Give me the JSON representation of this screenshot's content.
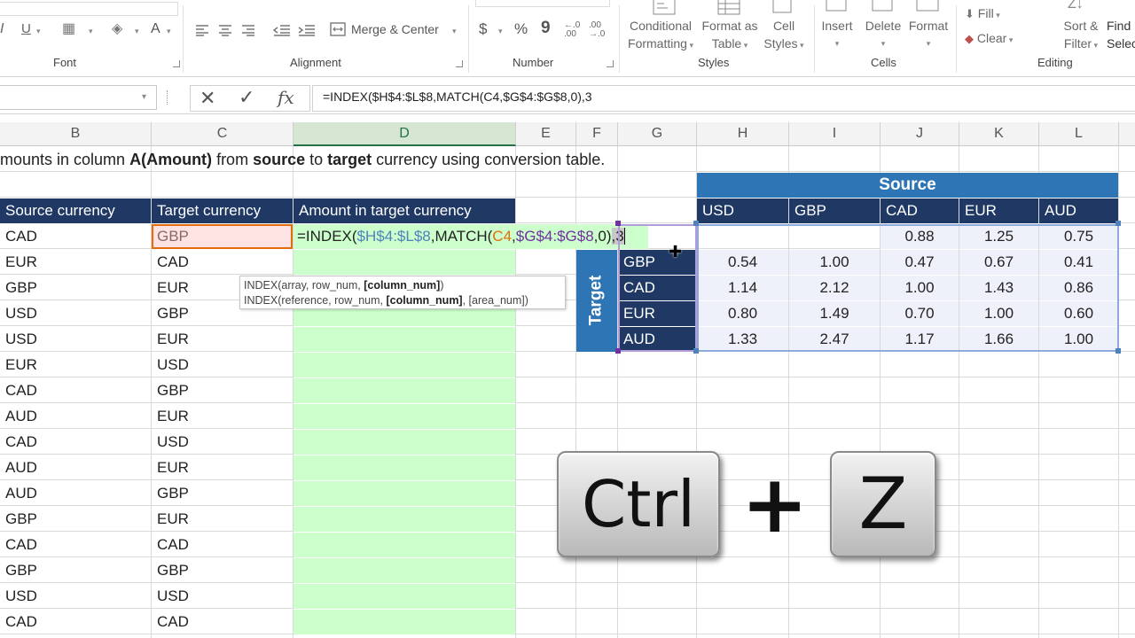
{
  "ribbon": {
    "font_group": "Font",
    "alignment_group": "Alignment",
    "number_group": "Number",
    "styles_group": "Styles",
    "cells_group": "Cells",
    "editing_group": "Editing",
    "merge_center": "Merge & Center",
    "dollar": "$",
    "percent": "%",
    "comma": "9",
    "conditional_formatting": [
      "Conditional",
      "Formatting"
    ],
    "format_as_table": [
      "Format as",
      "Table"
    ],
    "cell_styles": [
      "Cell",
      "Styles"
    ],
    "insert": "Insert",
    "delete": "Delete",
    "format": "Format",
    "fill": "Fill",
    "clear": "Clear",
    "sort_filter": [
      "Sort &",
      "Filter"
    ],
    "find_select": [
      "Find",
      "Selec"
    ],
    "underline": "U",
    "italic": "I",
    "font_color": "A"
  },
  "formula_bar": {
    "cancel": "✕",
    "enter": "✓",
    "fx": "fx",
    "formula": "=INDEX($H$4:$L$8,MATCH(C4,$G$4:$G$8,0),3"
  },
  "columns": [
    "B",
    "C",
    "D",
    "E",
    "F",
    "G",
    "H",
    "I",
    "J",
    "K",
    "L"
  ],
  "instruction": {
    "prefix": "mounts in column ",
    "bold1": "A(Amount)",
    "mid1": " from ",
    "bold2": "source",
    "mid2": " to ",
    "bold3": "target",
    "suffix": " currency using conversion table."
  },
  "table": {
    "headers": [
      "Source currency",
      "Target currency",
      "Amount in target currency"
    ],
    "rows": [
      [
        "CAD",
        "GBP"
      ],
      [
        "EUR",
        "CAD"
      ],
      [
        "GBP",
        "EUR"
      ],
      [
        "USD",
        "GBP"
      ],
      [
        "USD",
        "EUR"
      ],
      [
        "EUR",
        "USD"
      ],
      [
        "CAD",
        "GBP"
      ],
      [
        "AUD",
        "EUR"
      ],
      [
        "CAD",
        "USD"
      ],
      [
        "AUD",
        "EUR"
      ],
      [
        "AUD",
        "GBP"
      ],
      [
        "GBP",
        "EUR"
      ],
      [
        "CAD",
        "CAD"
      ],
      [
        "GBP",
        "GBP"
      ],
      [
        "USD",
        "USD"
      ],
      [
        "CAD",
        "CAD"
      ]
    ]
  },
  "editing_cell": {
    "p1": "=INDEX(",
    "p2": "$H$4:$L$8",
    "p3": ",MATCH(",
    "p4": "C4",
    "p5": ",",
    "p6": "$G$4:$G$8",
    "p7": ",0)",
    "p8": ",3"
  },
  "tooltip": {
    "line1a": "INDEX(array, row_num, ",
    "line1b": "[column_num]",
    "line1c": ")",
    "line2a": "INDEX(reference, row_num, ",
    "line2b": "[column_num]",
    "line2c": ", [area_num])"
  },
  "conversion": {
    "source_label": "Source",
    "target_label": "Target",
    "source_currencies": [
      "USD",
      "GBP",
      "CAD",
      "EUR",
      "AUD"
    ],
    "target_currencies": [
      "GBP",
      "CAD",
      "EUR",
      "AUD"
    ],
    "first_row_visible": [
      "0.88",
      "1.25",
      "0.75"
    ],
    "rows": [
      [
        "0.54",
        "1.00",
        "0.47",
        "0.67",
        "0.41"
      ],
      [
        "1.14",
        "2.12",
        "1.00",
        "1.43",
        "0.86"
      ],
      [
        "0.80",
        "1.49",
        "0.70",
        "1.00",
        "0.60"
      ],
      [
        "1.33",
        "2.47",
        "1.17",
        "1.66",
        "1.00"
      ]
    ]
  },
  "shortcut": {
    "key1": "Ctrl",
    "plus": "+",
    "key2": "Z"
  },
  "colors": {
    "header_blue": "#1f3864",
    "source_blue": "#2e75b6",
    "input_green": "#ccffcc",
    "ref_blue": "#4f81bd",
    "ref_orange": "#e46c0a",
    "ref_purple": "#7030a0",
    "excel_green": "#217346"
  }
}
